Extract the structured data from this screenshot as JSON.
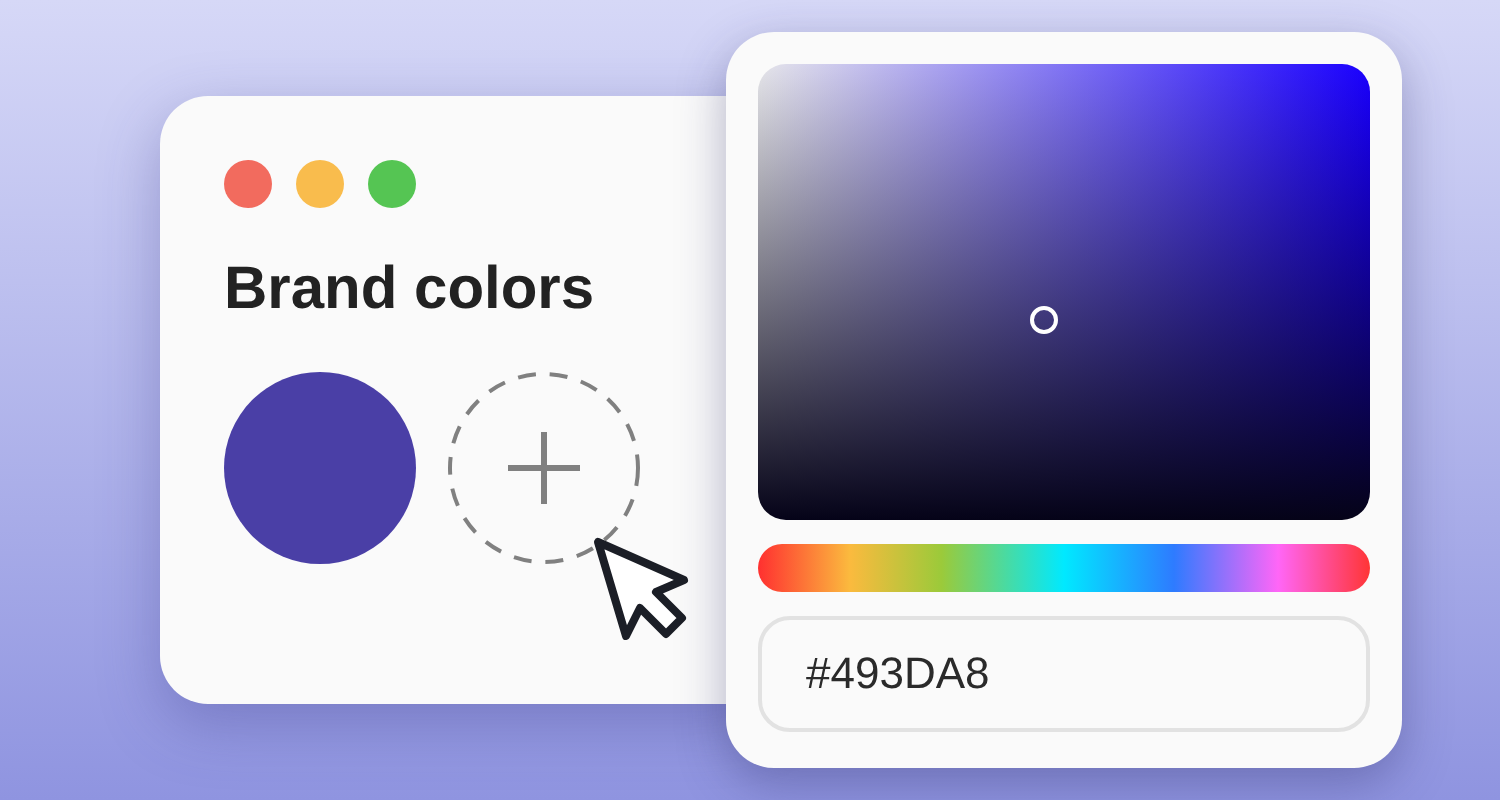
{
  "window": {
    "controls": [
      {
        "color": "#f26b5e"
      },
      {
        "color": "#f9bc4d"
      },
      {
        "color": "#55c553"
      }
    ]
  },
  "title": "Brand colors",
  "swatches": [
    {
      "kind": "color",
      "color": "#4a3fa6"
    },
    {
      "kind": "add"
    }
  ],
  "picker": {
    "hex_field": {
      "value": "#493DA8"
    }
  }
}
